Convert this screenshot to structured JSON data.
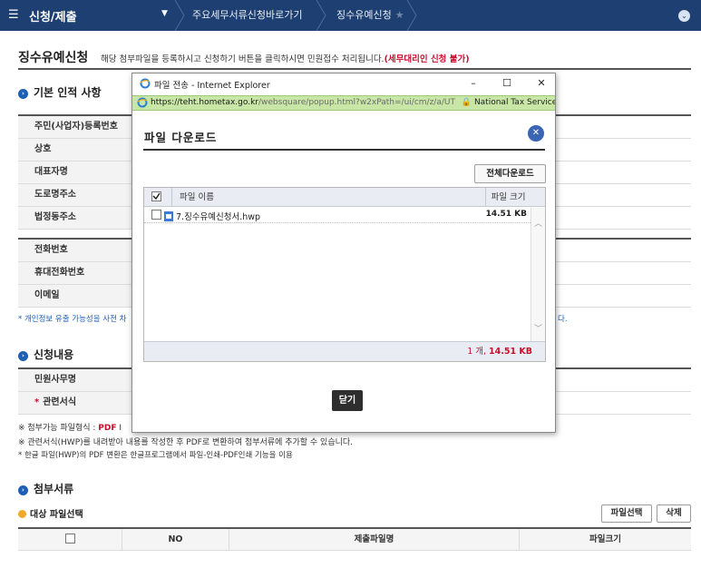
{
  "nav": {
    "title": "신청/제출",
    "crumb1": "주요세무서류신청바로가기",
    "crumb2": "징수유예신청"
  },
  "page": {
    "title": "징수유예신청",
    "desc_prefix": "해당 첨부파일을 등록하시고 신청하기 버튼을 클릭하시면 민원접수 처리됩니다.",
    "desc_warning": "(세무대리인 신청 불가)"
  },
  "basic": {
    "section_title": "기본 인적 사항",
    "fields": [
      "주민(사업자)등록번호",
      "상호",
      "대표자명",
      "도로명주소",
      "법정동주소",
      "전화번호",
      "휴대전화번호",
      "이메일"
    ],
    "privacy_note_start": "* 개인정보 유출 가능성을 사전 차",
    "privacy_note_end": "다."
  },
  "request": {
    "section_title": "신청내용",
    "fields": [
      "민원사무명",
      "관련서식"
    ],
    "required_mark": "*"
  },
  "notes": {
    "line1_prefix": "※ 첨부가능 파일형식 : ",
    "line1_pdf": "PDF",
    "line1_tail": "I",
    "line2": "※ 관련서식(HWP)를 내려받아 내용를 작성한 후 PDF로 변환하여 첨부서류에 추가할 수 있습니다.",
    "line3": "* 한글 파일(HWP)의 PDF 변환은 한글프로그램에서 파일-인쇄-PDF인쇄 기능을 이용"
  },
  "attach": {
    "section_title": "첨부서류",
    "sub_title": "대상 파일선택",
    "select_button": "파일선택",
    "delete_button": "삭제",
    "columns": [
      "NO",
      "제출파일명",
      "파일크기"
    ]
  },
  "popup": {
    "window_title": "파일 전송 - Internet Explorer",
    "address_host": "https://teht.hometax.go.kr",
    "address_path": "/websquare/popup.html?w2xPath=/ui/cm/z/a/UT",
    "address_cert": "National Tax Service [KR]",
    "minimize": "–",
    "maximize": "☐",
    "close": "✕",
    "heading": "파일 다운로드",
    "download_all": "전체다운로드",
    "col_name": "파일 이름",
    "col_size": "파일 크기",
    "files": [
      {
        "name": "7.징수유예신청서.hwp",
        "size": "14.51 KB"
      }
    ],
    "summary_count": "1 개, ",
    "summary_size": "14.51 KB",
    "close_button": "닫기"
  },
  "colors": {
    "nav_bg": "#1d3f71",
    "accent_blue": "#1e5fb6",
    "warning_red": "#c8102e",
    "address_bar_green": "#c8e6a5"
  },
  "icons": {
    "menu": "☰",
    "caret": "▼",
    "star": "★",
    "chevron_circle": "⌄",
    "close_circle": "✕",
    "scroll_up": "︿",
    "scroll_down": "﹀"
  }
}
